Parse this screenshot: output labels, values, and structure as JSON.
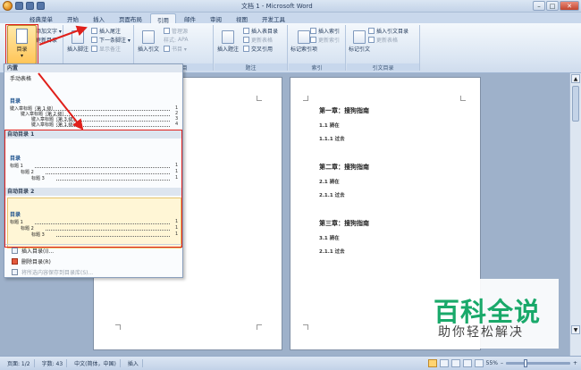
{
  "window": {
    "title": "文档 1 - Microsoft Word",
    "controls": {
      "minimize": "–",
      "maximize": "□",
      "close": "✕"
    }
  },
  "tabs": [
    "经典菜单",
    "开始",
    "插入",
    "页面布局",
    "引用",
    "邮件",
    "审阅",
    "视图",
    "开发工具"
  ],
  "active_tab": "引用",
  "ribbon": {
    "toc": {
      "label": "目录",
      "arrow": "▾",
      "add_text": "添加文字 ▾",
      "update_toc": "更新目录",
      "group": "目录"
    },
    "footnotes": {
      "insert_footnote": "插入脚注",
      "insert_endnote": "插入尾注",
      "next_footnote": "下一条脚注 ▾",
      "show_notes": "显示备注",
      "group": "脚注"
    },
    "citations": {
      "insert_citation": "插入引文",
      "manage_sources": "管理源",
      "style_label": "样式:",
      "style_value": "APA",
      "bibliography": "书目 ▾",
      "group": "引文与书目"
    },
    "captions": {
      "insert_caption": "插入题注",
      "insert_toc_figures": "插入表目录",
      "update_table": "更新表格",
      "cross_reference": "交叉引用",
      "group": "题注"
    },
    "index": {
      "mark_entry": "标记索引项",
      "insert_index": "插入索引",
      "update_index": "更新索引",
      "group": "索引"
    },
    "toa": {
      "mark_citation": "标记引文",
      "insert_toa": "插入引文目录",
      "update_toa": "更新表格",
      "group": "引文目录"
    }
  },
  "toc_dropdown": {
    "builtin_header": "内置",
    "manual_label": "手动表格",
    "manual_preview": {
      "title": "目录",
      "rows": [
        {
          "text": "键入章标题（第 1 级）",
          "num": "1"
        },
        {
          "text": "键入章标题（第 2 级）",
          "num": "2"
        },
        {
          "text": "键入章标题（第 3 级）",
          "num": "3"
        },
        {
          "text": "键入章标题（第 1 级）",
          "num": "4"
        }
      ]
    },
    "auto1_label": "自动目录 1",
    "auto1_preview": {
      "title": "目录",
      "rows": [
        {
          "text": "标题 1",
          "num": "1"
        },
        {
          "text": "标题 2",
          "num": "1"
        },
        {
          "text": "标题 3",
          "num": "1"
        }
      ]
    },
    "auto2_label": "自动目录 2",
    "auto2_preview": {
      "title": "目录",
      "rows": [
        {
          "text": "标题 1",
          "num": "1"
        },
        {
          "text": "标题 2",
          "num": "1"
        },
        {
          "text": "标题 3",
          "num": "1"
        }
      ]
    },
    "menu": {
      "insert_toc": "插入目录(I)...",
      "delete_toc": "删除目录(R)",
      "save_selection": "将所选内容保存到目录库(S)..."
    }
  },
  "document": {
    "page2": [
      {
        "type": "h",
        "text": "第一章：搜狗指南"
      },
      {
        "type": "s",
        "text": "1.1 骑在"
      },
      {
        "type": "s",
        "text": "1.1.1 过去"
      },
      {
        "type": "h",
        "text": "第二章：搜狗指南"
      },
      {
        "type": "s",
        "text": "2.1 骑在"
      },
      {
        "type": "s",
        "text": "2.1.1 过去"
      },
      {
        "type": "h",
        "text": "第三章：搜狗指南"
      },
      {
        "type": "s",
        "text": "3.1 骑在"
      },
      {
        "type": "s",
        "text": "2.1.1 过去"
      }
    ]
  },
  "watermark": {
    "title": "百科全说",
    "subtitle": "助你轻松解决"
  },
  "statusbar": {
    "page": "页面: 1/2",
    "words": "字数: 43",
    "language": "中文(简体，中国)",
    "mode": "插入",
    "zoom": "55%",
    "zoom_minus": "–",
    "zoom_plus": "+",
    "zoom_fraction": 0.3
  },
  "colors": {
    "annotation_red": "#e0201b",
    "watermark_green": "#19a96a"
  }
}
